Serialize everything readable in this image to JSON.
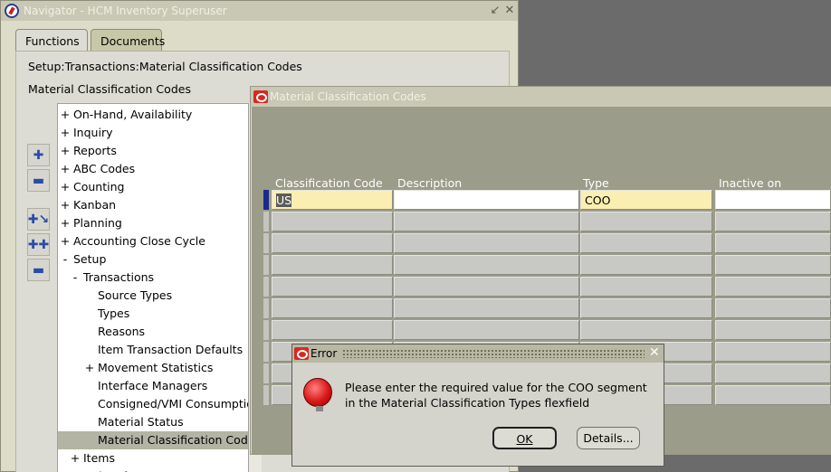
{
  "navigator": {
    "title": "Navigator - HCM Inventory Superuser",
    "tabs": [
      "Functions",
      "Documents"
    ],
    "breadcrumb": "Setup:Transactions:Material Classification Codes",
    "function_title": "Material Classification Codes",
    "tree": [
      {
        "exp": "+",
        "label": "On-Hand, Availability",
        "indent": 0
      },
      {
        "exp": "+",
        "label": "Inquiry",
        "indent": 0
      },
      {
        "exp": "+",
        "label": "Reports",
        "indent": 0
      },
      {
        "exp": "+",
        "label": "ABC Codes",
        "indent": 0
      },
      {
        "exp": "+",
        "label": "Counting",
        "indent": 0
      },
      {
        "exp": "+",
        "label": "Kanban",
        "indent": 0
      },
      {
        "exp": "+",
        "label": "Planning",
        "indent": 0
      },
      {
        "exp": "+",
        "label": "Accounting Close Cycle",
        "indent": 0
      },
      {
        "exp": "-",
        "label": "Setup",
        "indent": 0
      },
      {
        "exp": "-",
        "label": "Transactions",
        "indent": 1
      },
      {
        "exp": "",
        "label": "Source Types",
        "indent": 2
      },
      {
        "exp": "",
        "label": "Types",
        "indent": 2
      },
      {
        "exp": "",
        "label": "Reasons",
        "indent": 2
      },
      {
        "exp": "",
        "label": "Item Transaction Defaults",
        "indent": 2
      },
      {
        "exp": "+",
        "label": "Movement Statistics",
        "indent": 2
      },
      {
        "exp": "",
        "label": "Interface Managers",
        "indent": 2
      },
      {
        "exp": "",
        "label": "Consigned/VMI Consumption",
        "indent": 2
      },
      {
        "exp": "",
        "label": "Material Status",
        "indent": 2
      },
      {
        "exp": "",
        "label": "Material Classification Codes",
        "indent": 2
      },
      {
        "exp": "+",
        "label": "Items",
        "indent": 1
      },
      {
        "exp": "+",
        "label": "Units of Measure",
        "indent": 1
      }
    ],
    "selected_index": 18
  },
  "mcc": {
    "title": "Material Classification Codes",
    "columns": [
      "Classification Code",
      "Description",
      "Type",
      "Inactive on"
    ],
    "rows": [
      {
        "code": "US",
        "description": "",
        "type": "COO",
        "inactive": ""
      }
    ]
  },
  "error": {
    "title": "Error",
    "message": "Please enter the required value for the COO segment in the Material Classification Types flexfield",
    "ok_label": "OK",
    "details_label": "Details..."
  }
}
